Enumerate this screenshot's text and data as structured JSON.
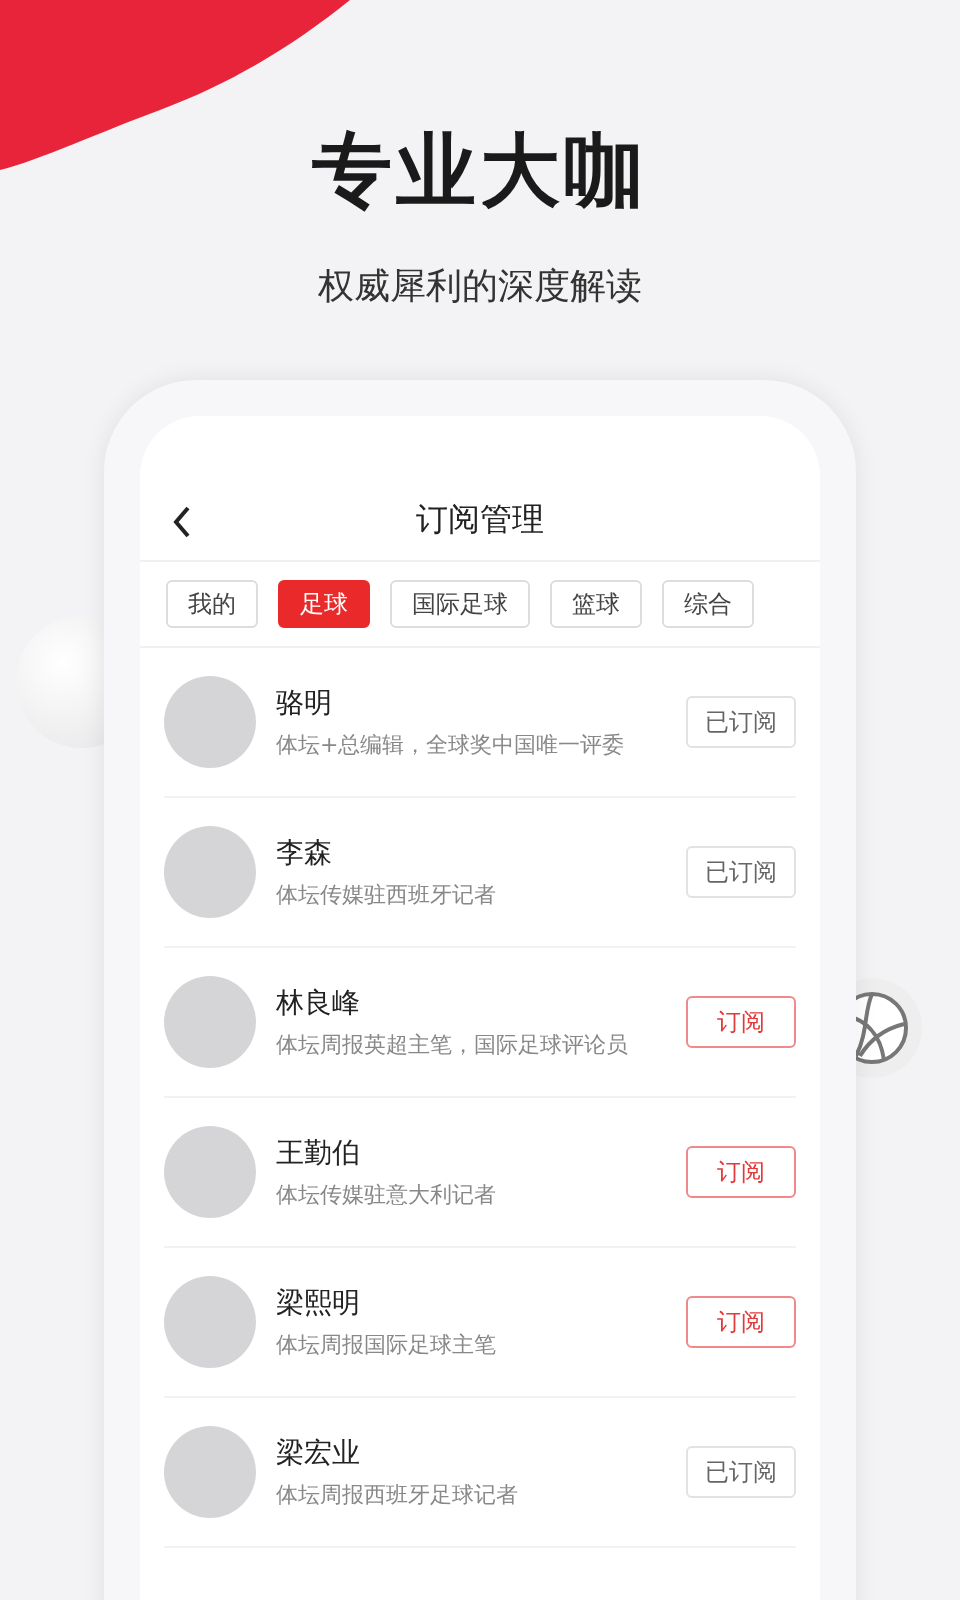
{
  "headline": "专业大咖",
  "subtitle": "权威犀利的深度解读",
  "screen": {
    "title": "订阅管理",
    "tabs": [
      {
        "label": "我的",
        "selected": false
      },
      {
        "label": "足球",
        "selected": true
      },
      {
        "label": "国际足球",
        "selected": false
      },
      {
        "label": "篮球",
        "selected": false
      },
      {
        "label": "综合",
        "selected": false
      }
    ],
    "experts": [
      {
        "name": "骆明",
        "bio": "体坛+总编辑，全球奖中国唯一评委",
        "button": "已订阅",
        "subscribed": true
      },
      {
        "name": "李森",
        "bio": "体坛传媒驻西班牙记者",
        "button": "已订阅",
        "subscribed": true
      },
      {
        "name": "林良峰",
        "bio": "体坛周报英超主笔，国际足球评论员",
        "button": "订阅",
        "subscribed": false
      },
      {
        "name": "王勤伯",
        "bio": "体坛传媒驻意大利记者",
        "button": "订阅",
        "subscribed": false
      },
      {
        "name": "梁熙明",
        "bio": "体坛周报国际足球主笔",
        "button": "订阅",
        "subscribed": false
      },
      {
        "name": "梁宏业",
        "bio": "体坛周报西班牙足球记者",
        "button": "已订阅",
        "subscribed": true
      }
    ]
  }
}
